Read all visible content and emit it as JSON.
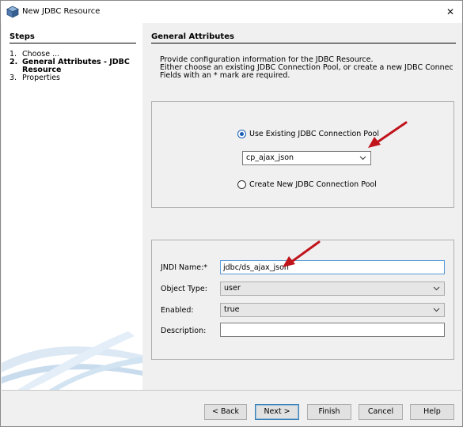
{
  "window": {
    "title": "New JDBC Resource",
    "close_glyph": "✕"
  },
  "steps": {
    "heading": "Steps",
    "items": [
      {
        "num": "1.",
        "label": "Choose ..."
      },
      {
        "num": "2.",
        "label": "General Attributes - JDBC Resource"
      },
      {
        "num": "3.",
        "label": "Properties"
      }
    ]
  },
  "content": {
    "heading": "General Attributes",
    "intro": [
      "Provide configuration information for the JDBC Resource.",
      "Either choose an existing JDBC Connection Pool, or create a new JDBC Connection F",
      "Fields with an * mark are required."
    ]
  },
  "pool": {
    "use_existing_label": "Use Existing JDBC Connection Pool",
    "use_existing_selected": true,
    "pool_value": "cp_ajax_json",
    "create_new_label": "Create New JDBC Connection Pool",
    "create_new_selected": false
  },
  "attributes": {
    "jndi_label": "JNDI Name:*",
    "jndi_value": "jdbc/ds_ajax_json",
    "object_type_label": "Object Type:",
    "object_type_value": "user",
    "enabled_label": "Enabled:",
    "enabled_value": "true",
    "description_label": "Description:",
    "description_value": ""
  },
  "buttons": {
    "back": "< Back",
    "next": "Next >",
    "finish": "Finish",
    "cancel": "Cancel",
    "help": "Help"
  },
  "icons": {
    "app": "app-cube-icon",
    "close": "close-icon",
    "dropdown": "chevron-down-icon",
    "annotation": "red-arrow-icon"
  },
  "colors": {
    "accent": "#1a5fb4",
    "annotation_arrow": "#c0141c"
  }
}
